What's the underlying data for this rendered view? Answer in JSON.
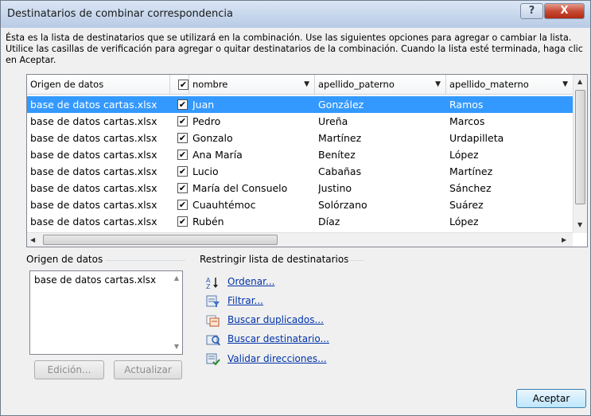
{
  "window": {
    "title": "Destinatarios de combinar correspondencia",
    "help_label": "?",
    "close_label": "X"
  },
  "description": "Ésta es la lista de destinatarios que se utilizará en la combinación. Use las siguientes opciones para agregar o cambiar la lista. Utilice las casillas de verificación para agregar o quitar destinatarios de la combinación. Cuando la lista esté terminada, haga clic en Aceptar.",
  "table": {
    "columns": [
      "Origen de datos",
      "",
      "nombre",
      "apellido_paterno",
      "apellido_materno"
    ],
    "rows": [
      {
        "origen": "base de datos cartas.xlsx",
        "checked": "✔",
        "nombre": "Juan",
        "paterno": "González",
        "materno": "Ramos"
      },
      {
        "origen": "base de datos cartas.xlsx",
        "checked": "✔",
        "nombre": "Pedro",
        "paterno": "Ureña",
        "materno": "Marcos"
      },
      {
        "origen": "base de datos cartas.xlsx",
        "checked": "✔",
        "nombre": "Gonzalo",
        "paterno": "Martínez",
        "materno": "Urdapilleta"
      },
      {
        "origen": "base de datos cartas.xlsx",
        "checked": "✔",
        "nombre": "Ana María",
        "paterno": "Benítez",
        "materno": "López"
      },
      {
        "origen": "base de datos cartas.xlsx",
        "checked": "✔",
        "nombre": "Lucio",
        "paterno": "Cabañas",
        "materno": "Martínez"
      },
      {
        "origen": "base de datos cartas.xlsx",
        "checked": "✔",
        "nombre": "María del Consuelo",
        "paterno": "Justino",
        "materno": "Sánchez"
      },
      {
        "origen": "base de datos cartas.xlsx",
        "checked": "✔",
        "nombre": "Cuauhtémoc",
        "paterno": "Solórzano",
        "materno": "Suárez"
      },
      {
        "origen": "base de datos cartas.xlsx",
        "checked": "✔",
        "nombre": "Rubén",
        "paterno": "Díaz",
        "materno": "López"
      }
    ],
    "selected_row": 0,
    "header_checkbox": "✔"
  },
  "data_source_group": {
    "label": "Origen de datos",
    "items": [
      "base de datos cartas.xlsx"
    ],
    "edit_button": "Edición...",
    "refresh_button": "Actualizar"
  },
  "refine_group": {
    "label": "Restringir lista de destinatarios",
    "actions": [
      {
        "label": "Ordenar...",
        "icon": "sort-icon"
      },
      {
        "label": "Filtrar...",
        "icon": "filter-icon"
      },
      {
        "label": "Buscar duplicados...",
        "icon": "find-duplicates-icon"
      },
      {
        "label": "Buscar destinatario...",
        "icon": "find-recipient-icon"
      },
      {
        "label": "Validar direcciones...",
        "icon": "validate-addresses-icon"
      }
    ]
  },
  "ok_button": "Aceptar",
  "colors": {
    "selection": "#3399ff",
    "link": "#0033aa",
    "close_button": "#c74b35"
  }
}
